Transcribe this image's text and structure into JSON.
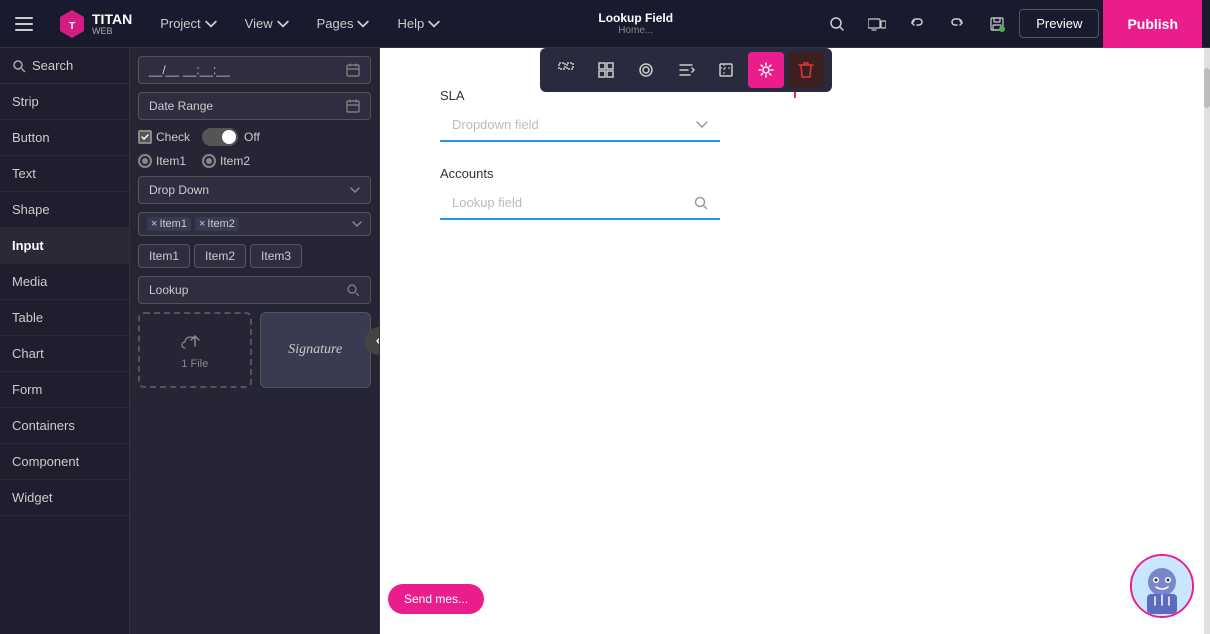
{
  "topNav": {
    "hamburgerLabel": "☰",
    "logoText": "TITAN",
    "logoSub": "WEB",
    "navItems": [
      {
        "label": "Project",
        "hasArrow": true
      },
      {
        "label": "View",
        "hasArrow": true
      },
      {
        "label": "Pages",
        "hasArrow": true
      },
      {
        "label": "Help",
        "hasArrow": true
      }
    ],
    "breadcrumb": {
      "title": "Lookup Field",
      "subtitle": "Home..."
    },
    "previewLabel": "Preview",
    "publishLabel": "Publish"
  },
  "sidebar": {
    "searchLabel": "Search",
    "items": [
      {
        "label": "Strip",
        "active": false
      },
      {
        "label": "Button",
        "active": false
      },
      {
        "label": "Text",
        "active": false
      },
      {
        "label": "Shape",
        "active": false
      },
      {
        "label": "Input",
        "active": true
      },
      {
        "label": "Media",
        "active": false
      },
      {
        "label": "Table",
        "active": false
      },
      {
        "label": "Chart",
        "active": false
      },
      {
        "label": "Form",
        "active": false
      },
      {
        "label": "Containers",
        "active": false
      },
      {
        "label": "Component",
        "active": false
      },
      {
        "label": "Widget",
        "active": false
      }
    ]
  },
  "componentPanel": {
    "datetime": {
      "date": "__/__",
      "time": "__:__:__"
    },
    "daterange": {
      "label": "Date Range"
    },
    "check": {
      "label": "Check"
    },
    "toggle": {
      "label": "Off"
    },
    "radios": [
      {
        "label": "Item1"
      },
      {
        "label": "Item2"
      }
    ],
    "dropdown": {
      "label": "Drop Down"
    },
    "multiselect": {
      "tags": [
        "Item1",
        "Item2"
      ]
    },
    "buttons": [
      "Item1",
      "Item2",
      "Item3"
    ],
    "lookup": {
      "label": "Lookup"
    },
    "upload": {
      "label": "1 File"
    },
    "signature": {
      "label": "Signature"
    }
  },
  "canvas": {
    "fields": [
      {
        "label": "SLA",
        "type": "dropdown",
        "placeholder": "Dropdown field"
      },
      {
        "label": "Accounts",
        "type": "lookup",
        "placeholder": "Lookup field"
      }
    ]
  },
  "toolbar": {
    "buttons": [
      {
        "name": "frame-icon",
        "label": "⬜",
        "active": false
      },
      {
        "name": "grid-icon",
        "label": "▦",
        "active": false
      },
      {
        "name": "eraser-icon",
        "label": "◈",
        "active": false
      },
      {
        "name": "align-icon",
        "label": "⊢",
        "active": false
      },
      {
        "name": "expand-icon",
        "label": "⬚",
        "active": false
      },
      {
        "name": "settings-icon",
        "label": "⚙",
        "active": true
      },
      {
        "name": "delete-icon",
        "label": "🗑",
        "active": false,
        "isDelete": true
      }
    ]
  },
  "sendMessage": {
    "label": "Send mes..."
  },
  "chatIcon": "🤖"
}
